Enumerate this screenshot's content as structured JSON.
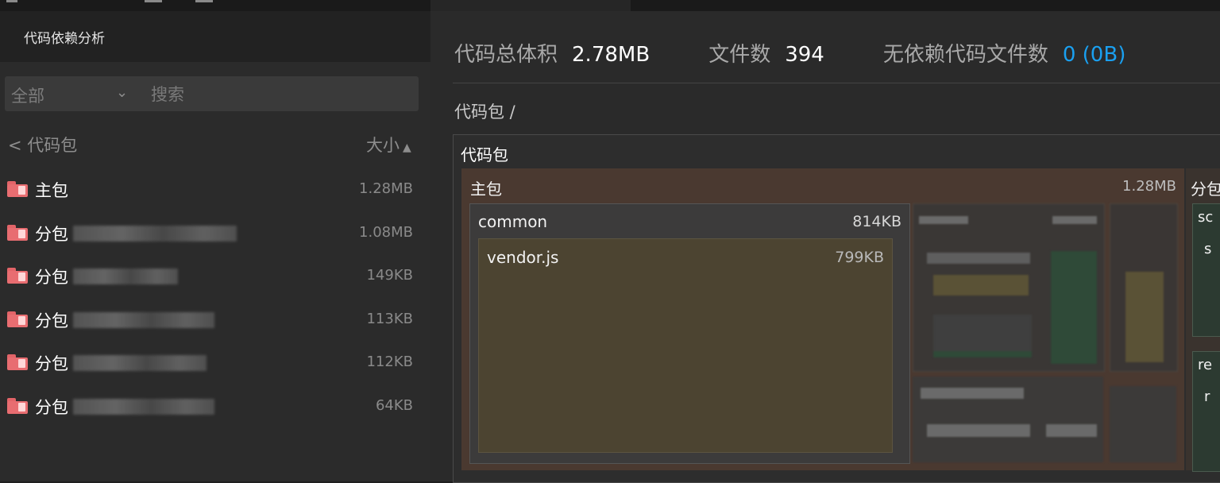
{
  "left_panel": {
    "title": "代码依赖分析",
    "filter": {
      "selected": "全部",
      "search_placeholder": "搜索"
    },
    "breadcrumb": "< 代码包",
    "sort_label": "大小",
    "packages": [
      {
        "name": "主包",
        "size": "1.28MB",
        "blurred": false
      },
      {
        "name": "分包",
        "size": "1.08MB",
        "blurred": true
      },
      {
        "name": "分包",
        "size": "149KB",
        "blurred": true
      },
      {
        "name": "分包",
        "size": "113KB",
        "blurred": true
      },
      {
        "name": "分包",
        "size": "112KB",
        "blurred": true
      },
      {
        "name": "分包",
        "size": "64KB",
        "blurred": true
      }
    ]
  },
  "stats": {
    "total_label": "代码总体积",
    "total_value": "2.78MB",
    "files_label": "文件数",
    "files_value": "394",
    "nodep_label": "无依赖代码文件数",
    "nodep_value": "0 (0B)"
  },
  "path": "代码包 /",
  "tree": {
    "root_label": "代码包",
    "main": {
      "label": "主包",
      "size": "1.28MB"
    },
    "common": {
      "label": "common",
      "size": "814KB"
    },
    "vendor": {
      "label": "vendor.js",
      "size": "799KB"
    },
    "sub": {
      "label": "分包",
      "box1": "sc",
      "box1_inner": "s",
      "box2": "re",
      "box2_inner": "r"
    }
  },
  "colors": {
    "accent_blue": "#1aa0f0",
    "folder": "#e86d71",
    "main_pkg": "#4a3930",
    "vendor": "#4c4431"
  }
}
